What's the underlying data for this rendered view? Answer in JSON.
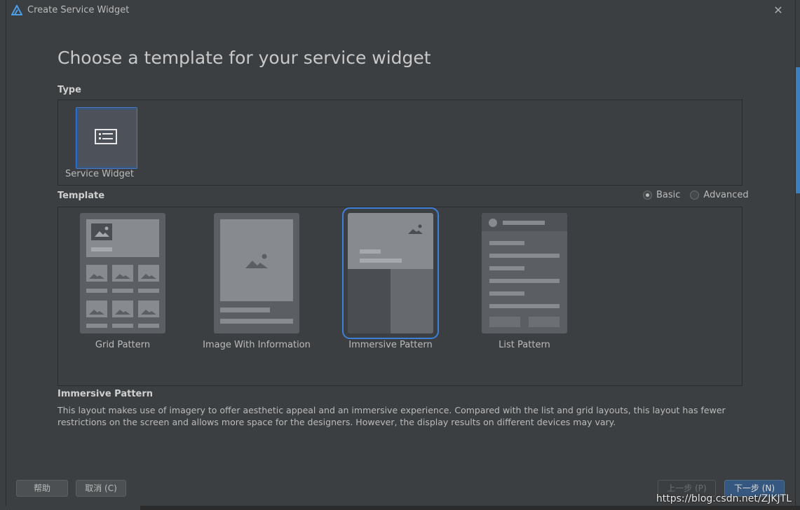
{
  "window": {
    "title": "Create Service Widget",
    "close_symbol": "✕"
  },
  "heading": "Choose a template for your service widget",
  "type_section": {
    "label": "Type",
    "items": [
      {
        "label": "Service Widget",
        "selected": true
      }
    ]
  },
  "template_section": {
    "label": "Template",
    "modes": [
      {
        "label": "Basic",
        "selected": true
      },
      {
        "label": "Advanced",
        "selected": false
      }
    ],
    "items": [
      {
        "label": "Grid Pattern",
        "selected": false
      },
      {
        "label": "Image With Information",
        "selected": false
      },
      {
        "label": "Immersive Pattern",
        "selected": true
      },
      {
        "label": "List Pattern",
        "selected": false
      }
    ]
  },
  "description": {
    "title": "Immersive Pattern",
    "text": "This layout makes use of imagery to offer aesthetic appeal and an immersive experience. Compared with the list and grid layouts, this layout has fewer restrictions on the screen and allows more space for the designers. However, the display results on different devices may vary."
  },
  "buttons": {
    "help": "帮助",
    "cancel": "取消 (C)",
    "previous": "上一步 (P)",
    "next": "下一步 (N)"
  },
  "watermark": "https://blog.csdn.net/ZJKJTL",
  "colors": {
    "accent": "#3d7fd9",
    "background": "#3c3f41",
    "primary_button": "#365880"
  }
}
